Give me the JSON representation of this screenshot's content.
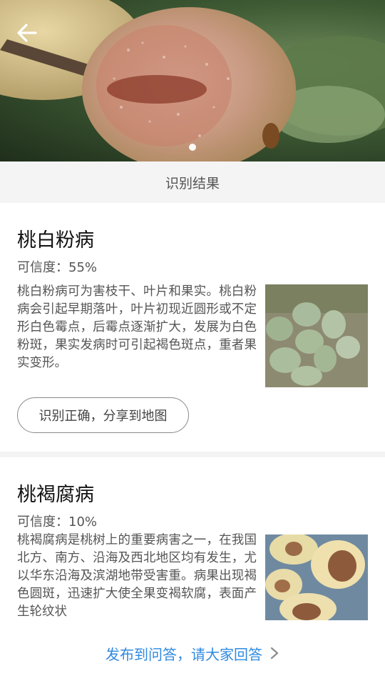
{
  "section_title": "识别结果",
  "results": [
    {
      "name": "桃白粉病",
      "confidence": "可信度：55%",
      "description": "桃白粉病可为害枝干、叶片和果实。桃白粉病会引起早期落叶，叶片初现近圆形或不定形白色霉点，后霉点逐渐扩大，发展为白色粉斑，果实发病时可引起褐色斑点，重者果实变形。",
      "share_label": "识别正确，分享到地图"
    },
    {
      "name": "桃褐腐病",
      "confidence": "可信度：10%",
      "description": "桃褐腐病是桃树上的重要病害之一，在我国北方、南方、沿海及西北地区均有发生，尤以华东沿海及滨湖地带受害重。病果出现褐色圆斑，迅速扩大使全果变褐软腐，表面产生轮纹状"
    }
  ],
  "bottom": {
    "ask_label": "发布到问答，请大家回答"
  },
  "icons": {
    "back": "arrow-left-icon",
    "chevron": "chevron-right-icon"
  },
  "colors": {
    "link": "#2f8ae0",
    "background_gray": "#f4f4f4"
  }
}
